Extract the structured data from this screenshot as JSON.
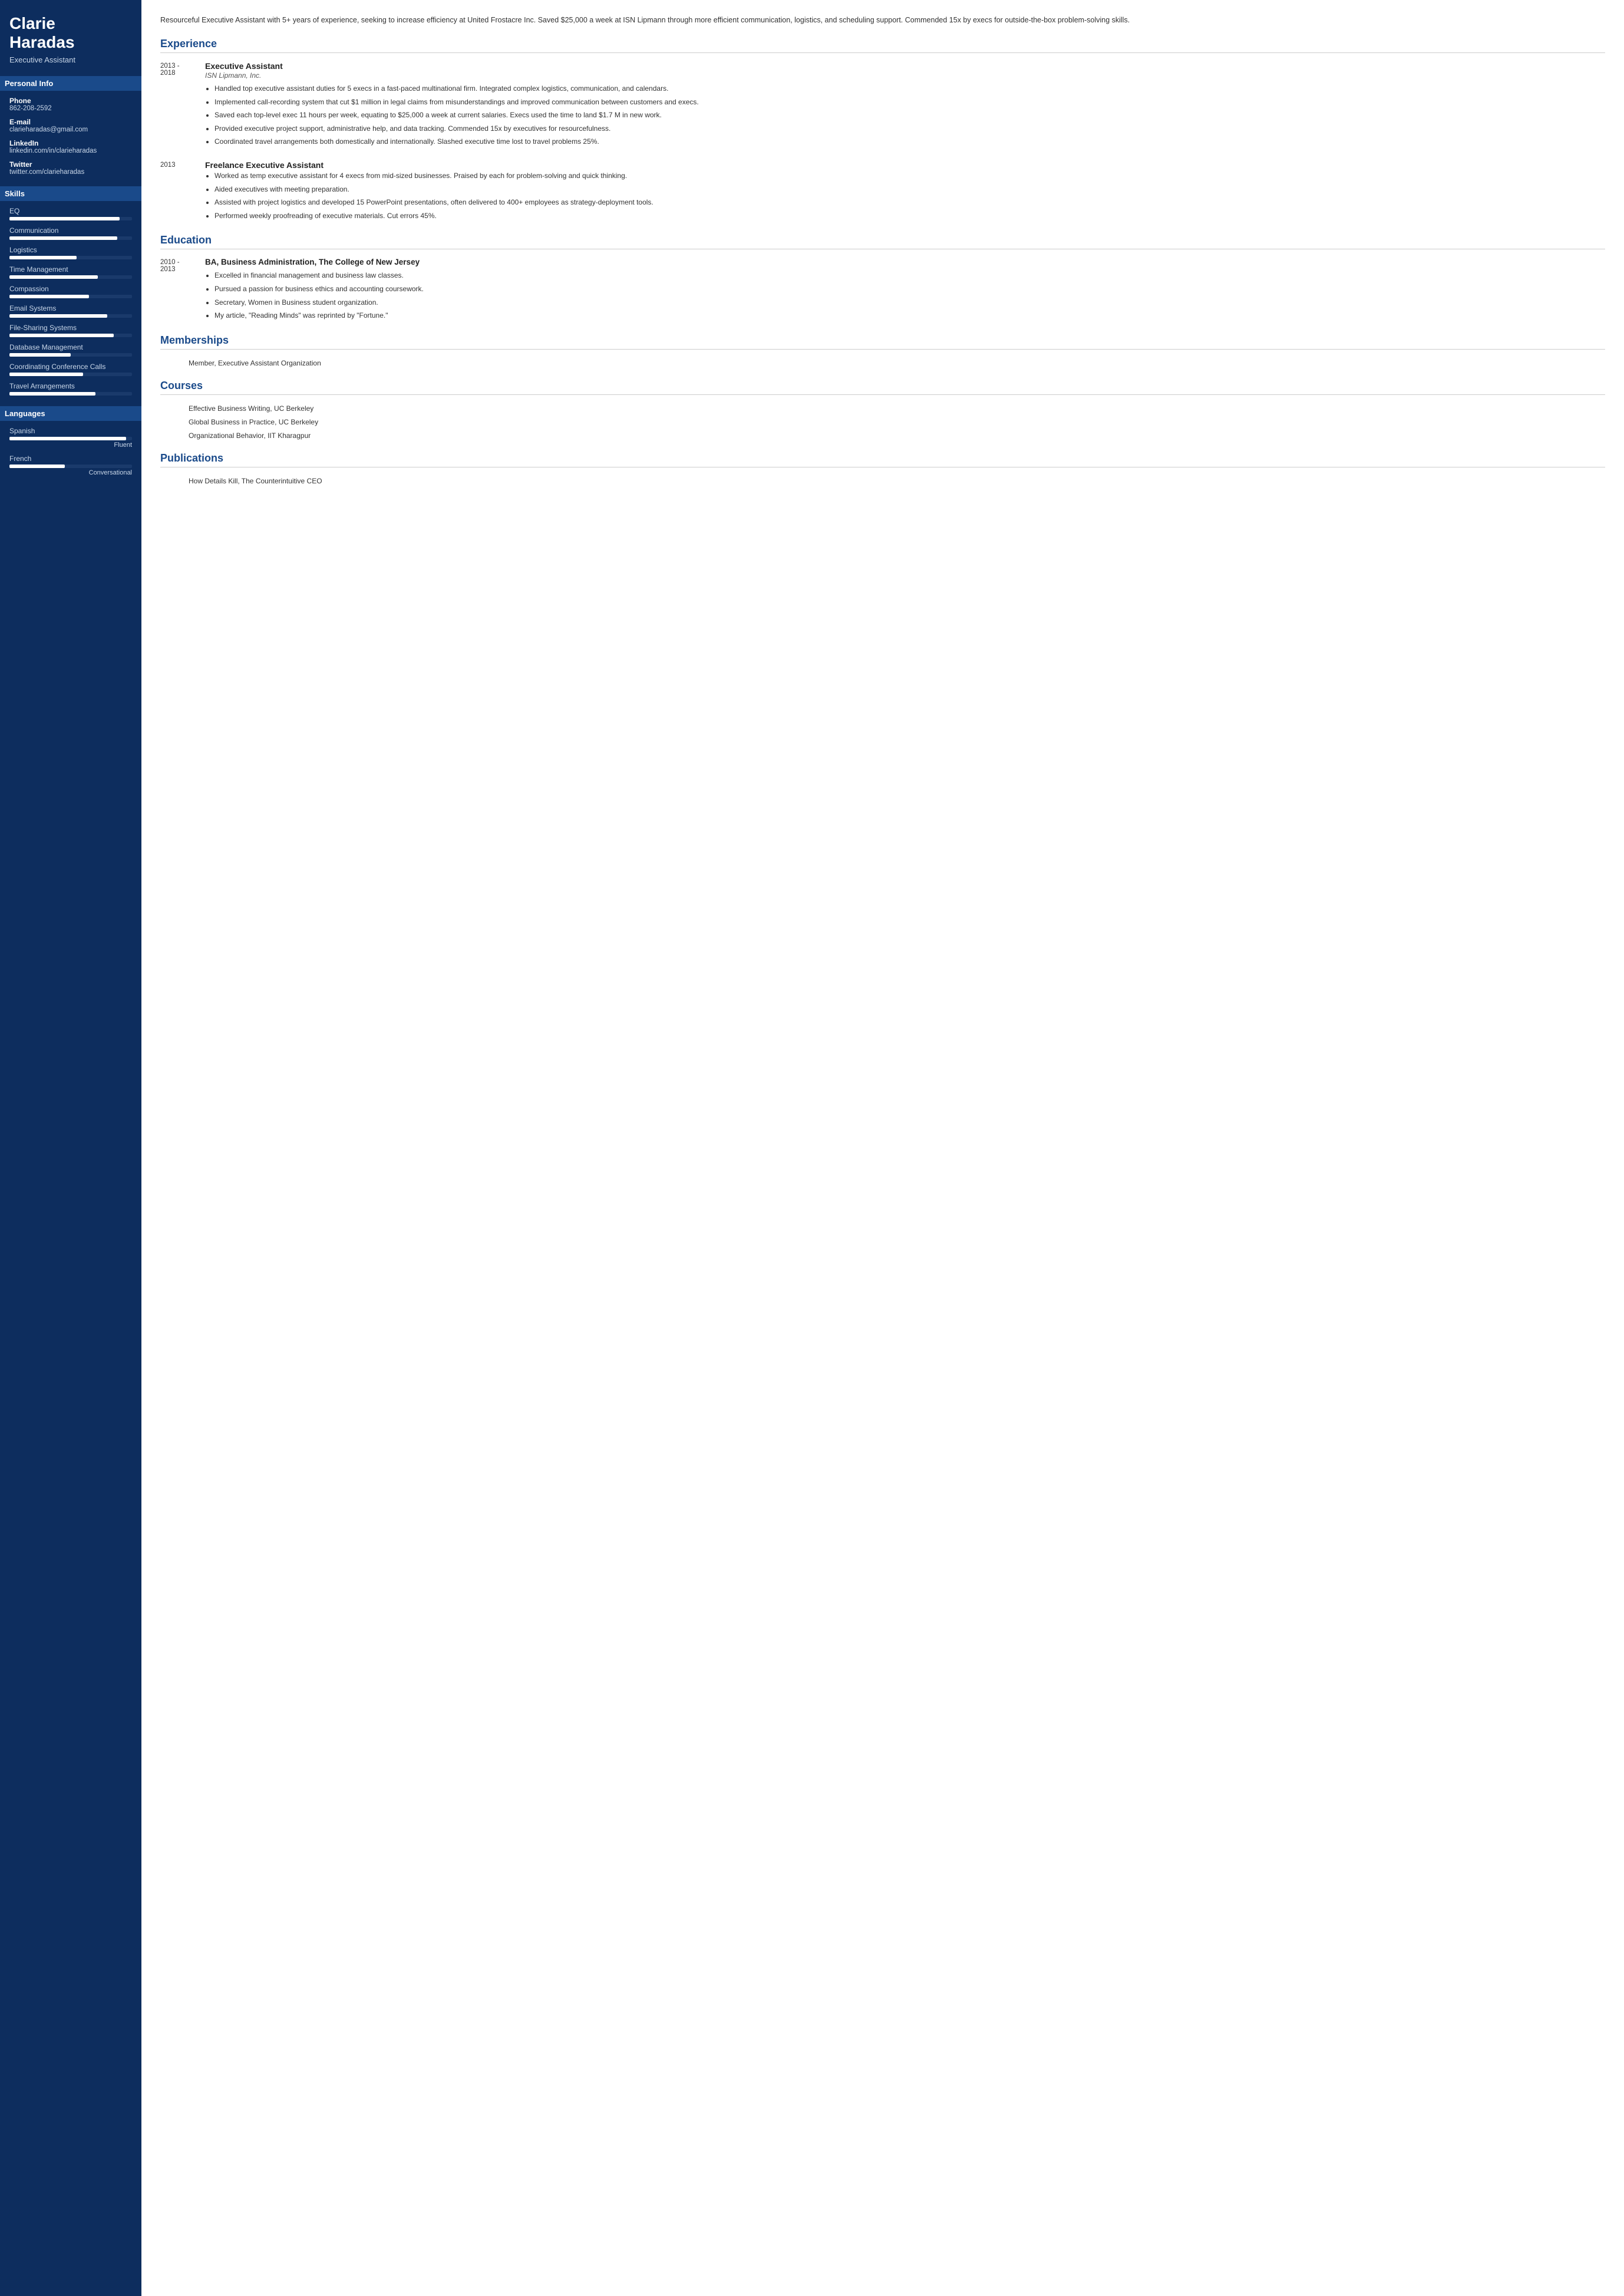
{
  "sidebar": {
    "name": "Clarie\nHaradas",
    "title": "Executive Assistant",
    "personal_info_label": "Personal Info",
    "contact": [
      {
        "label": "Phone",
        "value": "862-208-2592"
      },
      {
        "label": "E-mail",
        "value": "clarieharadas@gmail.com"
      },
      {
        "label": "LinkedIn",
        "value": "linkedin.com/in/clarieharadas"
      },
      {
        "label": "Twitter",
        "value": "twitter.com/clarieharadas"
      }
    ],
    "skills_label": "Skills",
    "skills": [
      {
        "name": "EQ",
        "pct": 90
      },
      {
        "name": "Communication",
        "pct": 88
      },
      {
        "name": "Logistics",
        "pct": 55
      },
      {
        "name": "Time Management",
        "pct": 72
      },
      {
        "name": "Compassion",
        "pct": 65
      },
      {
        "name": "Email Systems",
        "pct": 80
      },
      {
        "name": "File-Sharing Systems",
        "pct": 85
      },
      {
        "name": "Database Management",
        "pct": 50
      },
      {
        "name": "Coordinating Conference Calls",
        "pct": 60
      },
      {
        "name": "Travel Arrangements",
        "pct": 70
      }
    ],
    "languages_label": "Languages",
    "languages": [
      {
        "name": "Spanish",
        "pct": 95,
        "level": "Fluent"
      },
      {
        "name": "French",
        "pct": 45,
        "level": "Conversational"
      }
    ]
  },
  "main": {
    "summary": "Resourceful Executive Assistant with 5+ years of experience, seeking to increase efficiency at United Frostacre Inc. Saved $25,000 a week at ISN Lipmann through more efficient communication, logistics, and scheduling support. Commended 15x by execs for outside-the-box problem-solving skills.",
    "experience_label": "Experience",
    "experience": [
      {
        "dates": "2013 -\n2018",
        "title": "Executive Assistant",
        "company": "ISN Lipmann, Inc.",
        "bullets": [
          "Handled top executive assistant duties for 5 execs in a fast-paced multinational firm. Integrated complex logistics, communication, and calendars.",
          "Implemented call-recording system that cut $1 million in legal claims from misunderstandings and improved communication between customers and execs.",
          "Saved each top-level exec 11 hours per week, equating to $25,000 a week at current salaries. Execs used the time to land $1.7 M in new work.",
          "Provided executive project support, administrative help, and data tracking. Commended 15x by executives for resourcefulness.",
          "Coordinated travel arrangements both domestically and internationally. Slashed executive time lost to travel problems 25%."
        ]
      },
      {
        "dates": "2013",
        "title": "Freelance Executive Assistant",
        "company": "",
        "bullets": [
          "Worked as temp executive assistant for 4 execs from mid-sized businesses. Praised by each for problem-solving and quick thinking.",
          "Aided executives with meeting preparation.",
          "Assisted with project logistics and developed 15 PowerPoint presentations, often delivered to 400+ employees as strategy-deployment tools.",
          "Performed weekly proofreading of executive materials. Cut errors 45%."
        ]
      }
    ],
    "education_label": "Education",
    "education": [
      {
        "dates": "2010 -\n2013",
        "degree": "BA, Business Administration, The College of New Jersey",
        "bullets": [
          "Excelled in financial management and business law classes.",
          "Pursued a passion for business ethics and accounting coursework.",
          "Secretary, Women in Business student organization.",
          "My article, \"Reading Minds\" was reprinted by \"Fortune.\""
        ]
      }
    ],
    "memberships_label": "Memberships",
    "memberships": [
      "Member, Executive Assistant Organization"
    ],
    "courses_label": "Courses",
    "courses": [
      "Effective Business Writing, UC Berkeley",
      "Global Business in Practice, UC Berkeley",
      "Organizational Behavior, IIT Kharagpur"
    ],
    "publications_label": "Publications",
    "publications": [
      "How Details Kill, The Counterintuitive CEO"
    ]
  }
}
